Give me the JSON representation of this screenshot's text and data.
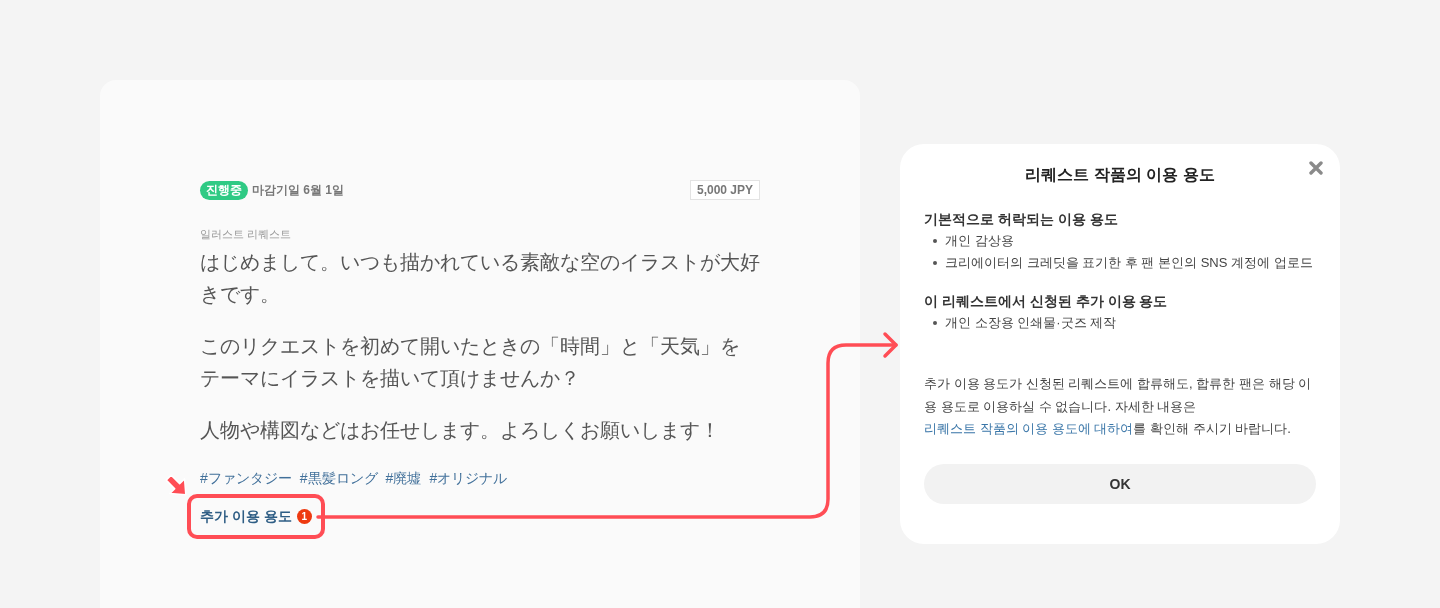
{
  "request_card": {
    "status_badge": "진행중",
    "deadline": "마감기일 6월 1일",
    "price": "5,000 JPY",
    "category": "일러스트 리퀘스트",
    "message_paragraphs": [
      "はじめまして。いつも描かれている素敵な空のイラストが大好きです。",
      "このリクエストを初めて開いたときの「時間」と「天気」をテーマにイラストを描いて頂けませんか？",
      "人物や構図などはお任せします。よろしくお願いします！"
    ],
    "hashtags": [
      "#ファンタジー",
      "#黒髪ロング",
      "#廃墟",
      "#オリジナル"
    ],
    "additional_usage": {
      "label": "추가 이용 용도",
      "count": "1"
    }
  },
  "usage_dialog": {
    "title": "리퀘스트 작품의 이용 용도",
    "sections": [
      {
        "heading": "기본적으로 허락되는 이용 용도",
        "items": [
          "개인 감상용",
          "크리에이터의 크레딧을 표기한 후 팬 본인의 SNS 계정에 업로드"
        ]
      },
      {
        "heading": "이 리퀘스트에서 신청된 추가 이용 용도",
        "items": [
          "개인 소장용 인쇄물·굿즈 제작"
        ]
      }
    ],
    "note": {
      "before": "추가 이용 용도가 신청된 리퀘스트에 합류해도, 합류한 팬은 해당 이용 용도로 이용하실 수 없습니다. 자세한 내용은 ",
      "link": "리퀘스트 작품의 이용 용도에 대하여",
      "after": "를 확인해 주시기 바랍니다."
    },
    "ok_button": "OK"
  }
}
